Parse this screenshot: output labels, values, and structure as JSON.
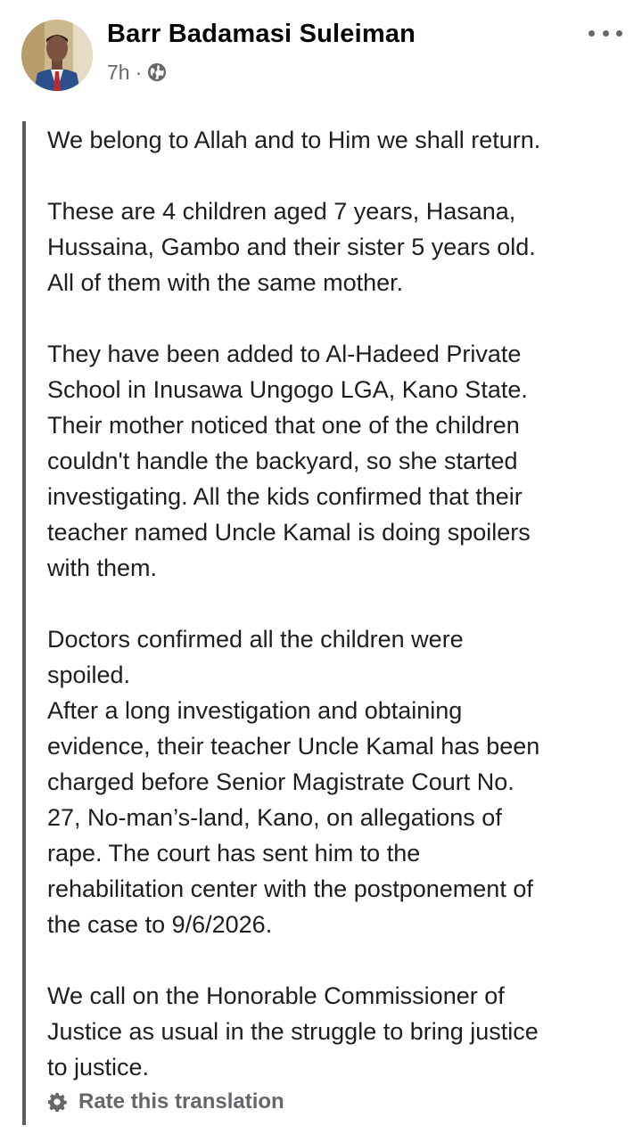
{
  "post": {
    "author": "Barr Badamasi Suleiman",
    "time": "7h",
    "separator": "·",
    "visibility_icon": "globe-icon",
    "more_icon": "more-horizontal-icon",
    "paragraphs": [
      [
        "We belong to Allah and to Him we shall return."
      ],
      [
        "These are 4 children aged 7 years, Hasana,",
        "Hussaina, Gambo and their sister 5 years old.",
        "All of them with the same mother."
      ],
      [
        "They have been added to Al-Hadeed Private",
        "School in Inusawa Ungogo LGA, Kano State.",
        "Their mother noticed that one of the children",
        "couldn't handle the backyard, so she started",
        "investigating. All the kids confirmed that their",
        "teacher named Uncle Kamal is doing spoilers",
        "with them."
      ],
      [
        "Doctors confirmed all the children were",
        "spoiled.",
        "After a long investigation and obtaining",
        "evidence, their teacher Uncle Kamal has been",
        "charged before Senior Magistrate Court No.",
        "27, No-man’s-land, Kano, on allegations of",
        "rape. The court has sent him to the",
        "rehabilitation center with the postponement of",
        "the case to 9/6/2026."
      ],
      [
        "We call on the Honorable Commissioner of",
        "Justice as usual in the struggle to bring justice",
        "to justice."
      ]
    ],
    "rate_translation": {
      "icon": "gear-icon",
      "label": "Rate this translation"
    }
  },
  "colors": {
    "text": "#1c1e21",
    "secondary": "#65676b",
    "quote_bar": "#5c5c5c"
  }
}
